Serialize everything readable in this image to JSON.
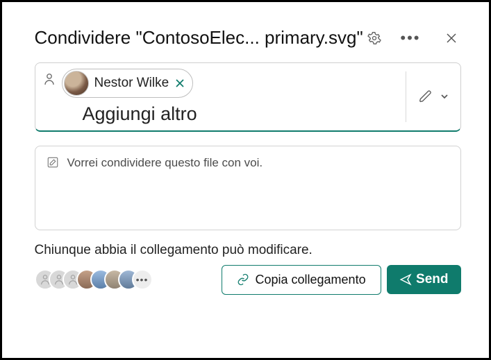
{
  "header": {
    "title": "Condividere \"ContosoElec... primary.svg\""
  },
  "recipients": {
    "chip_name": "Nestor Wilke",
    "add_more": "Aggiungi altro"
  },
  "message": {
    "text": "Vorrei condividere questo file con voi."
  },
  "footer": {
    "permission_text": "Chiunque abbia il collegamento può modificare.",
    "more_people": "•••",
    "copy_label": "Copia collegamento",
    "send_label": "Send"
  }
}
